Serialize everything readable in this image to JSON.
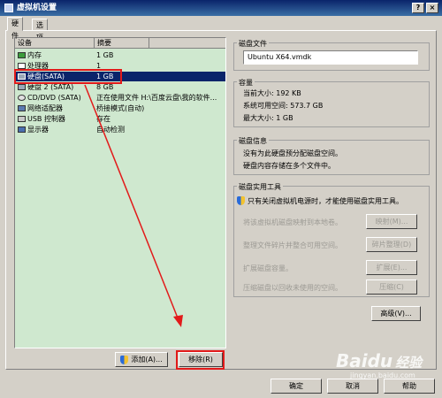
{
  "window": {
    "title": "虚拟机设置",
    "close_glyph": "×",
    "help_glyph": "?"
  },
  "tabs": [
    {
      "label": "硬件"
    },
    {
      "label": "选项"
    }
  ],
  "device_list": {
    "columns": [
      "设备",
      "摘要"
    ],
    "rows": [
      {
        "name": "内存",
        "summary": "1 GB",
        "icon": "memory-icon"
      },
      {
        "name": "处理器",
        "summary": "1",
        "icon": "cpu-icon"
      },
      {
        "name": "硬盘(SATA)",
        "summary": "1 GB",
        "icon": "hard-disk-icon",
        "selected": true
      },
      {
        "name": "硬盘 2 (SATA)",
        "summary": "8 GB",
        "icon": "hard-disk-icon"
      },
      {
        "name": "CD/DVD (SATA)",
        "summary": "正在使用文件 H:\\百度云盘\\我的软件...",
        "icon": "cd-dvd-icon"
      },
      {
        "name": "网络适配器",
        "summary": "桥接模式(自动)",
        "icon": "network-adapter-icon"
      },
      {
        "name": "USB 控制器",
        "summary": "存在",
        "icon": "usb-icon"
      },
      {
        "name": "显示器",
        "summary": "自动检测",
        "icon": "display-icon"
      }
    ],
    "add_label": "添加(A)...",
    "remove_label": "移除(R)"
  },
  "disk_file": {
    "legend": "磁盘文件",
    "value": "Ubuntu X64.vmdk"
  },
  "capacity": {
    "legend": "容量",
    "current_size": "当前大小: 192 KB",
    "free_space": "系统可用空间: 573.7 GB",
    "max_size": "最大大小: 1 GB"
  },
  "disk_info": {
    "legend": "磁盘信息",
    "line1": "没有为此硬盘预分配磁盘空间。",
    "line2": "硬盘内容存储在多个文件中。"
  },
  "disk_utilities": {
    "legend": "磁盘实用工具",
    "notice": "只有关闭虚拟机电源时，才能使用磁盘实用工具。",
    "map_desc": "将该虚拟机磁盘映射到本地卷。",
    "map_label": "映射(M)...",
    "defrag_desc": "整理文件碎片并整合可用空间。",
    "defrag_label": "碎片整理(D)",
    "expand_desc": "扩展磁盘容量。",
    "expand_label": "扩展(E)...",
    "compact_desc": "压缩磁盘以回收未使用的空间。",
    "compact_label": "压缩(C)"
  },
  "advanced_label": "高级(V)...",
  "footer": {
    "ok_label": "确定",
    "cancel_label": "取消",
    "help_label": "帮助"
  },
  "watermark": {
    "brand": "Baidu",
    "sub": "经验",
    "url": "jingyan.baidu.com"
  },
  "colors": {
    "annotation_red": "#e21a1a",
    "selection": "#0a246a",
    "list_bg": "#cfe8cf"
  }
}
